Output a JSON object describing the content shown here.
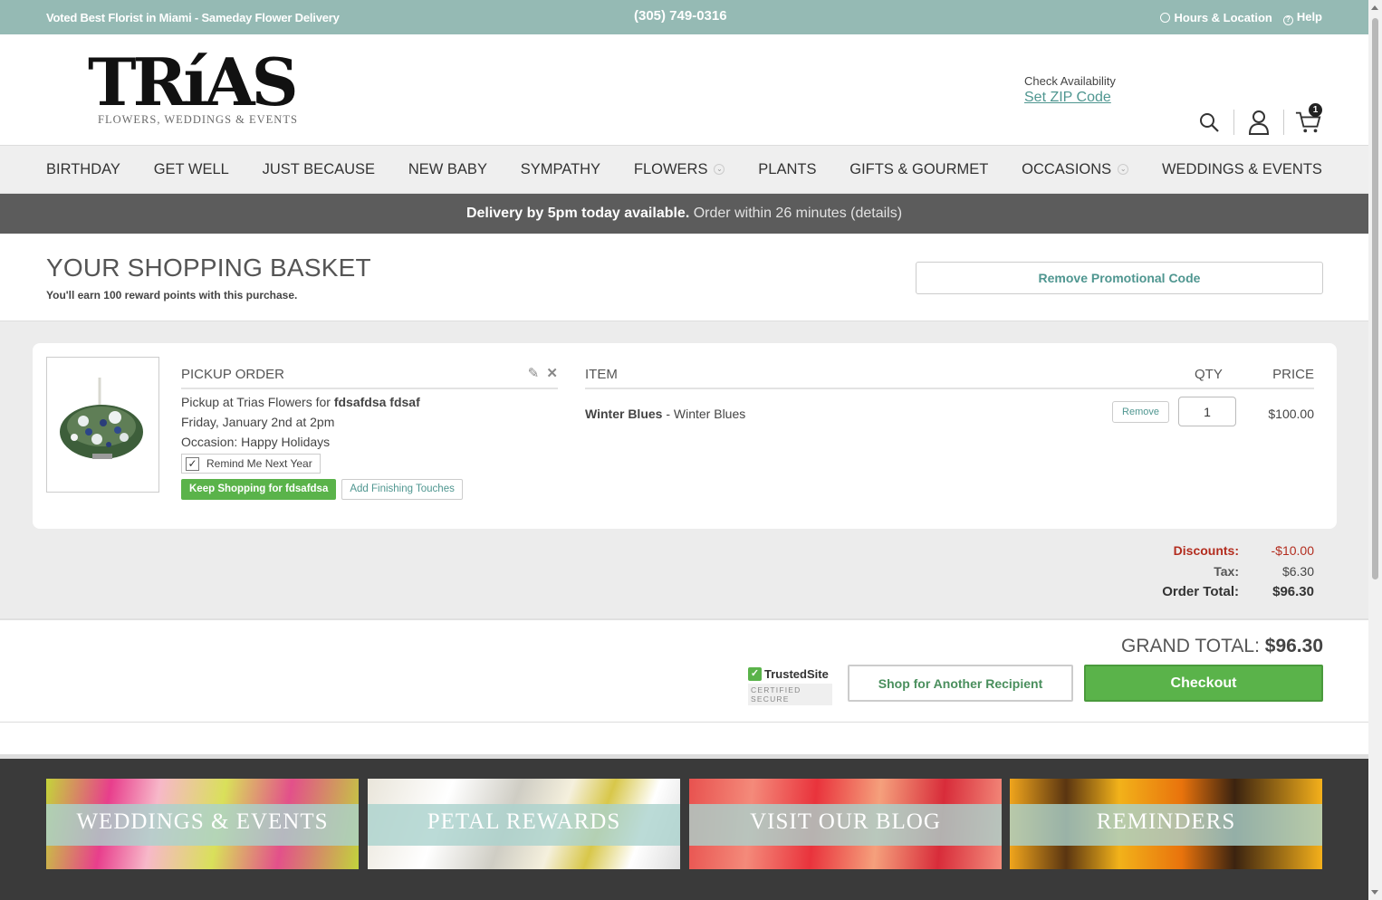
{
  "topbar": {
    "tagline": "Voted Best Florist in Miami - Sameday Flower Delivery",
    "phone": "(305) 749-0316",
    "hours": "Hours & Location",
    "help": "Help"
  },
  "header": {
    "logo_word": "TRíAS",
    "logo_sub": "FLOWERS, WEDDINGS & EVENTS",
    "check_label": "Check Availability",
    "zip_link": "Set ZIP Code",
    "cart_count": "1"
  },
  "nav": {
    "items": [
      "Birthday",
      "Get Well",
      "Just Because",
      "New Baby",
      "Sympathy",
      "Flowers",
      "Plants",
      "Gifts & Gourmet",
      "Occasions",
      "Weddings & Events"
    ]
  },
  "banner": {
    "bold": "Delivery by 5pm today available.",
    "normal": "Order within 26 minutes",
    "details": "(details)"
  },
  "basket": {
    "title": "YOUR SHOPPING BASKET",
    "points": "You'll earn 100 reward points with this purchase.",
    "promo_button": "Remove Promotional Code"
  },
  "order": {
    "section_title": "PICKUP ORDER",
    "pickup_prefix": "Pickup at Trias Flowers for",
    "recipient": "fdsafdsa fdsaf",
    "date": "Friday, January 2nd at 2pm",
    "occasion": "Occasion: Happy Holidays",
    "remind": "Remind Me Next Year",
    "keep_shopping": "Keep Shopping for fdsafdsa",
    "finishing": "Add Finishing Touches"
  },
  "items": {
    "col_item": "ITEM",
    "col_qty": "QTY",
    "col_price": "PRICE",
    "rows": [
      {
        "name": "Winter Blues",
        "variant": "- Winter Blues",
        "remove": "Remove",
        "qty": "1",
        "price": "$100.00"
      }
    ]
  },
  "totals": {
    "discounts_label": "Discounts:",
    "discounts": "-$10.00",
    "tax_label": "Tax:",
    "tax": "$6.30",
    "order_label": "Order Total:",
    "order_total": "$96.30",
    "grand_label": "GRAND TOTAL:",
    "grand_total": "$96.30"
  },
  "actions": {
    "trusted": "TrustedSite",
    "certified": "CERTIFIED SECURE",
    "shop_another": "Shop for Another Recipient",
    "checkout": "Checkout"
  },
  "footer": {
    "tiles": [
      "WEDDINGS & EVENTS",
      "PETAL REWARDS",
      "VISIT OUR BLOG",
      "REMINDERS"
    ]
  },
  "colors": {
    "topbar": "#95bab4",
    "accent_teal": "#4f9690",
    "checkout_green": "#5ab34a",
    "discount_red": "#b32d1f"
  }
}
